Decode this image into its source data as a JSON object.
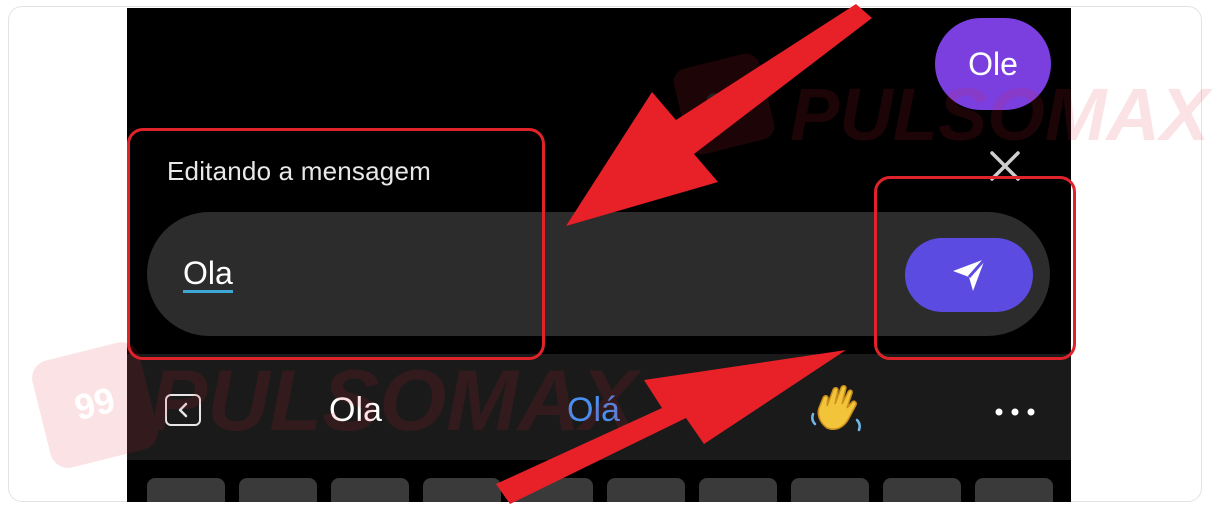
{
  "chat": {
    "message_bubble": "Ole"
  },
  "edit_panel": {
    "label": "Editando a mensagem",
    "input_value": "Ola"
  },
  "suggestions": {
    "items": [
      "Ola",
      "Olá"
    ]
  },
  "watermark": {
    "text": "PULSOMAX",
    "badge": "99"
  },
  "colors": {
    "bubble": "#7b3fe0",
    "send_button": "#5b4be0",
    "input_bar": "#2c2c2c",
    "highlight": "#e0232b",
    "suggestion_accent": "#4a8ff0",
    "input_underline": "#3fa7d6"
  },
  "icons": {
    "close": "close-icon",
    "send": "send-icon",
    "back": "chevron-left-icon",
    "emoji": "waving-hand-emoji",
    "more": "more-horizontal-icon"
  }
}
